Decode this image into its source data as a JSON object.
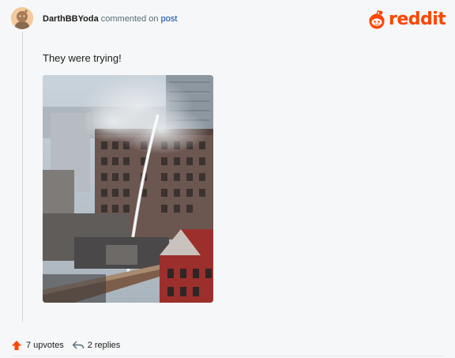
{
  "comment": {
    "author": "DarthBBYoda",
    "action_text": "commented on",
    "post_link_text": "post",
    "body": "They were trying!",
    "image_alt": "Tall building with firefighters spraying water while smoke rises",
    "upvotes_text": "7 upvotes",
    "replies_text": "2 replies"
  },
  "brand": {
    "name": "reddit",
    "color": "#ff4500"
  },
  "icons": {
    "avatar": "snoo-avatar-icon",
    "logo": "reddit-snoo-icon",
    "upvote": "upvote-arrow-icon",
    "reply": "reply-arrow-icon"
  }
}
